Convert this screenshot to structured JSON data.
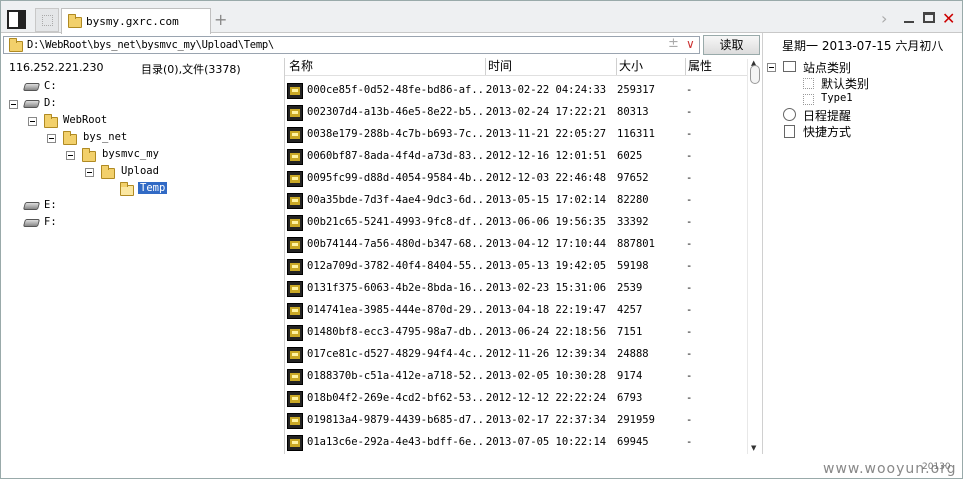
{
  "tab": {
    "title": "bysmy.gxrc.com"
  },
  "address": {
    "path": "D:\\WebRoot\\bys_net\\bysmvc_my\\Upload\\Temp\\"
  },
  "read_button": "读取",
  "date": "星期一 2013-07-15 六月初八",
  "status": {
    "ip": "116.252.221.230",
    "counts": "目录(0),文件(3378)"
  },
  "columns": {
    "name": "名称",
    "time": "时间",
    "size": "大小",
    "attr": "属性"
  },
  "tree": {
    "c": "C:",
    "d": "D:",
    "webroot": "WebRoot",
    "bys_net": "bys_net",
    "bysmvc_my": "bysmvc_my",
    "upload": "Upload",
    "temp": "Temp",
    "e": "E:",
    "f": "F:"
  },
  "files": [
    {
      "name": "000ce85f-0d52-48fe-bd86-af...",
      "time": "2013-02-22 04:24:33",
      "size": "259317",
      "attr": "-"
    },
    {
      "name": "002307d4-a13b-46e5-8e22-b5...",
      "time": "2013-02-24 17:22:21",
      "size": "80313",
      "attr": "-"
    },
    {
      "name": "0038e179-288b-4c7b-b693-7c...",
      "time": "2013-11-21 22:05:27",
      "size": "116311",
      "attr": "-"
    },
    {
      "name": "0060bf87-8ada-4f4d-a73d-83...",
      "time": "2012-12-16 12:01:51",
      "size": "6025",
      "attr": "-"
    },
    {
      "name": "0095fc99-d88d-4054-9584-4b...",
      "time": "2012-12-03 22:46:48",
      "size": "97652",
      "attr": "-"
    },
    {
      "name": "00a35bde-7d3f-4ae4-9dc3-6d...",
      "time": "2013-05-15 17:02:14",
      "size": "82280",
      "attr": "-"
    },
    {
      "name": "00b21c65-5241-4993-9fc8-df...",
      "time": "2013-06-06 19:56:35",
      "size": "33392",
      "attr": "-"
    },
    {
      "name": "00b74144-7a56-480d-b347-68...",
      "time": "2013-04-12 17:10:44",
      "size": "887801",
      "attr": "-"
    },
    {
      "name": "012a709d-3782-40f4-8404-55...",
      "time": "2013-05-13 19:42:05",
      "size": "59198",
      "attr": "-"
    },
    {
      "name": "0131f375-6063-4b2e-8bda-16...",
      "time": "2013-02-23 15:31:06",
      "size": "2539",
      "attr": "-"
    },
    {
      "name": "014741ea-3985-444e-870d-29...",
      "time": "2013-04-18 22:19:47",
      "size": "4257",
      "attr": "-"
    },
    {
      "name": "01480bf8-ecc3-4795-98a7-db...",
      "time": "2013-06-24 22:18:56",
      "size": "7151",
      "attr": "-"
    },
    {
      "name": "017ce81c-d527-4829-94f4-4c...",
      "time": "2012-11-26 12:39:34",
      "size": "24888",
      "attr": "-"
    },
    {
      "name": "0188370b-c51a-412e-a718-52...",
      "time": "2013-02-05 10:30:28",
      "size": "9174",
      "attr": "-"
    },
    {
      "name": "018b04f2-269e-4cd2-bf62-53...",
      "time": "2012-12-12 22:22:24",
      "size": "6793",
      "attr": "-"
    },
    {
      "name": "019813a4-9879-4439-b685-d7...",
      "time": "2013-02-17 22:37:34",
      "size": "291959",
      "attr": "-"
    },
    {
      "name": "01a13c6e-292a-4e43-bdff-6e...",
      "time": "2013-07-05 10:22:14",
      "size": "69945",
      "attr": "-"
    }
  ],
  "right_panel": {
    "site_category": "站点类别",
    "default_category": "默认类别",
    "type1": "Type1",
    "schedule": "日程提醒",
    "shortcut": "快捷方式"
  },
  "watermark": "www.wooyun.org",
  "version": "20130"
}
